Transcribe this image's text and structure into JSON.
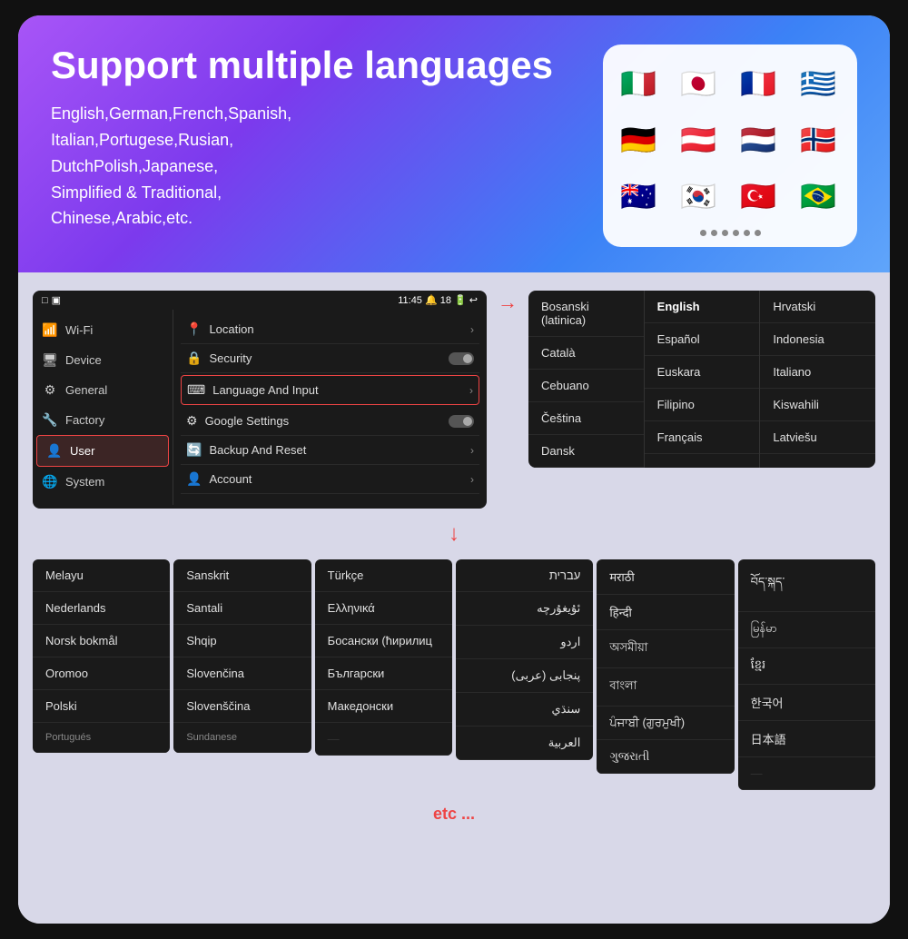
{
  "top": {
    "title": "Support multiple languages",
    "subtitle": "English,German,French,Spanish,\nItalian,Portugese,Rusian,\nDutchPolish,Japanese,\nSimplified & Traditional,\nChinese,Arabic,etc."
  },
  "flags": [
    "🇮🇹",
    "🇯🇵",
    "🇫🇷",
    "🇬🇷",
    "🇩🇪",
    "🇦🇹",
    "🇳🇱",
    "🇳🇴",
    "🇦🇺",
    "🇰🇷",
    "🇹🇷",
    "🇧🇷"
  ],
  "statusBar": {
    "left": "□  ▣",
    "center": "11:45 🔔 18 🔋 ↩",
    "time": "11:45"
  },
  "sidebar": {
    "items": [
      {
        "icon": "📶",
        "label": "Wi-Fi",
        "active": false
      },
      {
        "icon": "🖥",
        "label": "Device",
        "active": false
      },
      {
        "icon": "⚙",
        "label": "General",
        "active": false
      },
      {
        "icon": "🔧",
        "label": "Factory",
        "active": false
      },
      {
        "icon": "👤",
        "label": "User",
        "active": true
      },
      {
        "icon": "🌐",
        "label": "System",
        "active": false
      }
    ]
  },
  "settings": [
    {
      "icon": "📍",
      "label": "Location",
      "type": "arrow"
    },
    {
      "icon": "🔒",
      "label": "Security",
      "type": "toggle"
    },
    {
      "icon": "⌨",
      "label": "Language And Input",
      "type": "arrow",
      "highlighted": true
    },
    {
      "icon": "⚙",
      "label": "Google Settings",
      "type": "toggle"
    },
    {
      "icon": "🔄",
      "label": "Backup And Reset",
      "type": "arrow"
    },
    {
      "icon": "👤",
      "label": "Account",
      "type": "arrow"
    }
  ],
  "langListRight": {
    "col1": [
      "Bosanski (latinica)",
      "Català",
      "Cebuano",
      "Čeština",
      "Dansk"
    ],
    "col2": [
      "English",
      "Español",
      "Euskara",
      "Filipino",
      "Français"
    ],
    "col3": [
      "Hrvatski",
      "Indonesia",
      "Italiano",
      "Kiswahili",
      "Latviešu"
    ]
  },
  "bottomLangs": {
    "col1": [
      "Melayu",
      "Nederlands",
      "Norsk bokmål",
      "Oromoo",
      "Polski",
      "Portugués"
    ],
    "col2": [
      "Sanskrit",
      "Santali",
      "Shqip",
      "Slovenčina",
      "Slovenščina",
      "Sundanese"
    ],
    "col3": [
      "Türkçe",
      "Ελληνικά",
      "Босански (ћирилиц",
      "Български",
      "Македонски",
      ""
    ],
    "col4": [
      "עברית",
      "ئۇيغۇرچە",
      "اردو",
      "پنجابی (عربی)",
      "سنڌي",
      "العربية"
    ],
    "col5": [
      "मराठी",
      "हिन्दी",
      "অসমীয়া",
      "বাংলা",
      "ਪੰਜਾਬੀ (ਗੁਰਮੁਖੀ)",
      "ગુજરાતી"
    ],
    "col6": [
      "བོད་སྐད་",
      "မြန်မာ",
      "ខ្មែរ",
      "한국어",
      "日本語",
      ""
    ]
  },
  "etc": "etc ..."
}
